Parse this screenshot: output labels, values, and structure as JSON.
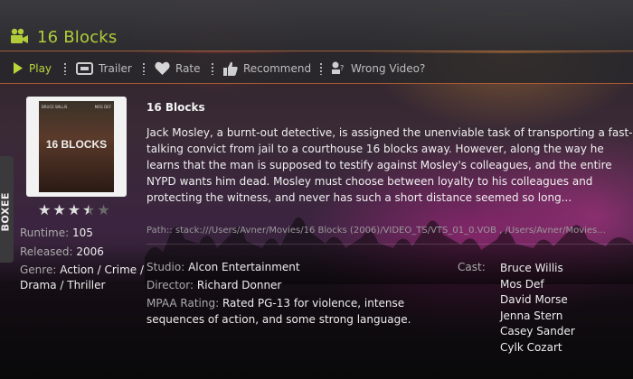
{
  "header": {
    "title": "16 Blocks"
  },
  "toolbar": {
    "play": "Play",
    "trailer": "Trailer",
    "rate": "Rate",
    "recommend": "Recommend",
    "wrong_video": "Wrong Video?"
  },
  "side_tab": {
    "label": "BOXEE"
  },
  "poster": {
    "cast_left": "BRUCE WILLIS",
    "cast_right": "MOS DEF",
    "title": "16 BLOCKS"
  },
  "rating": {
    "stars": 3.5,
    "max": 5
  },
  "meta": {
    "runtime_label": "Runtime:",
    "runtime": "105",
    "released_label": "Released:",
    "released": "2006",
    "genre_label": "Genre:",
    "genre_line1": "Action / Crime /",
    "genre_line2": "Drama / Thriller"
  },
  "movie": {
    "title": "16 Blocks",
    "description": "Jack Mosley, a burnt-out detective, is assigned the unenviable task of transporting a fast-talking convict from jail to a courthouse 16 blocks away. However, along the way he learns that the man is supposed to testify against Mosley's colleagues, and the entire NYPD wants him dead. Mosley must choose between loyalty to his colleagues and protecting the witness, and never has such a short distance seemed so long...",
    "path": "Path:: stack:///Users/Avner/Movies/16 Blocks (2006)/VIDEO_TS/VTS_01_0.VOB , /Users/Avner/Movies..."
  },
  "details": {
    "studio_label": "Studio:",
    "studio": "Alcon Entertainment",
    "director_label": "Director:",
    "director": "Richard Donner",
    "mpaa_label": "MPAA Rating:",
    "mpaa_line1": "Rated PG-13 for violence, intense",
    "mpaa_line2": "sequences of action, and some strong language."
  },
  "cast": {
    "label": "Cast:",
    "members": [
      "Bruce Willis",
      "Mos Def",
      "David Morse",
      "Jenna Stern",
      "Casey Sander",
      "Cylk Cozart"
    ]
  },
  "colors": {
    "accent": "#b8d63a",
    "star_filled": "#e0e0e0",
    "star_empty": "#6a6a6a"
  },
  "icons": [
    "video-camera-icon",
    "play-icon",
    "trailer-icon",
    "heart-icon",
    "thumbs-up-icon",
    "wrong-video-icon"
  ]
}
